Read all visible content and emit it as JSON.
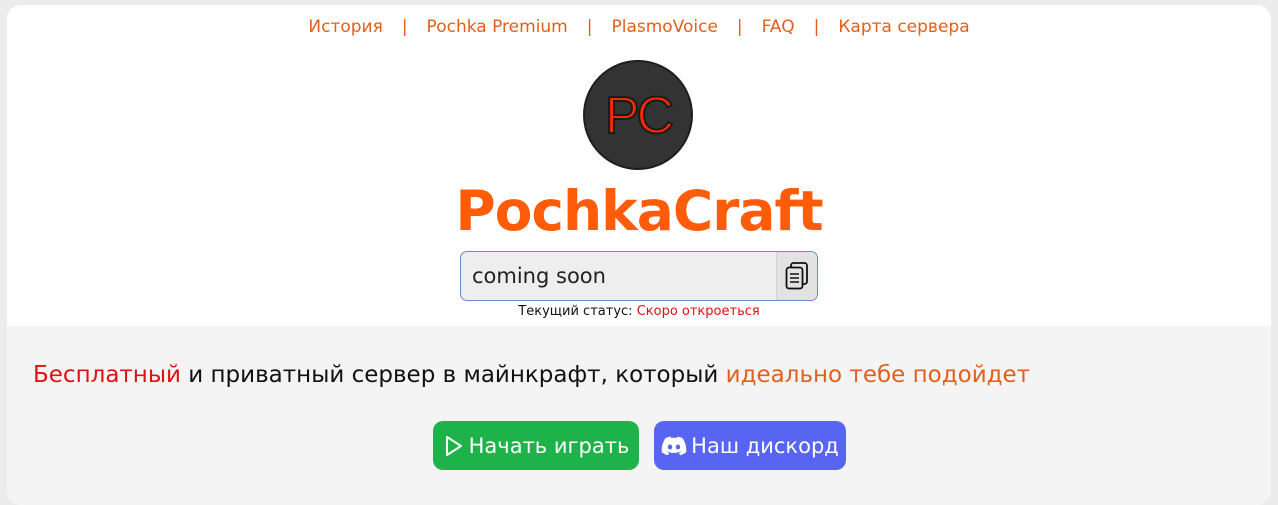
{
  "nav": {
    "items": [
      {
        "label": "История"
      },
      {
        "label": "Pochka Premium"
      },
      {
        "label": "PlasmoVoice"
      },
      {
        "label": "FAQ"
      },
      {
        "label": "Карта сервера"
      }
    ],
    "separator": "|"
  },
  "logo": {
    "text": "PC",
    "icon": "server-logo-icon",
    "colors": {
      "background": "#333333",
      "text": "#ff2a00"
    }
  },
  "brand": {
    "title": "PochkaCraft",
    "color": "#ff5c0a"
  },
  "server_address": {
    "value": "coming soon",
    "copy_icon": "copy-icon"
  },
  "status": {
    "label": "Текущий статус:",
    "value": "Скоро откроеться",
    "value_color": "#e31010"
  },
  "tagline": {
    "part1": "Бесплатный",
    "part2": " и приватный сервер в майнкрафт, который ",
    "part3": "идеально тебе подойдет"
  },
  "buttons": {
    "play": {
      "label": "Начать играть",
      "icon": "play-icon",
      "color": "#1eb34a"
    },
    "discord": {
      "label": "Наш дискорд",
      "icon": "discord-icon",
      "color": "#5865f2"
    }
  },
  "colors": {
    "accent": "#e0601c",
    "lower_background": "#f4f4f4"
  }
}
